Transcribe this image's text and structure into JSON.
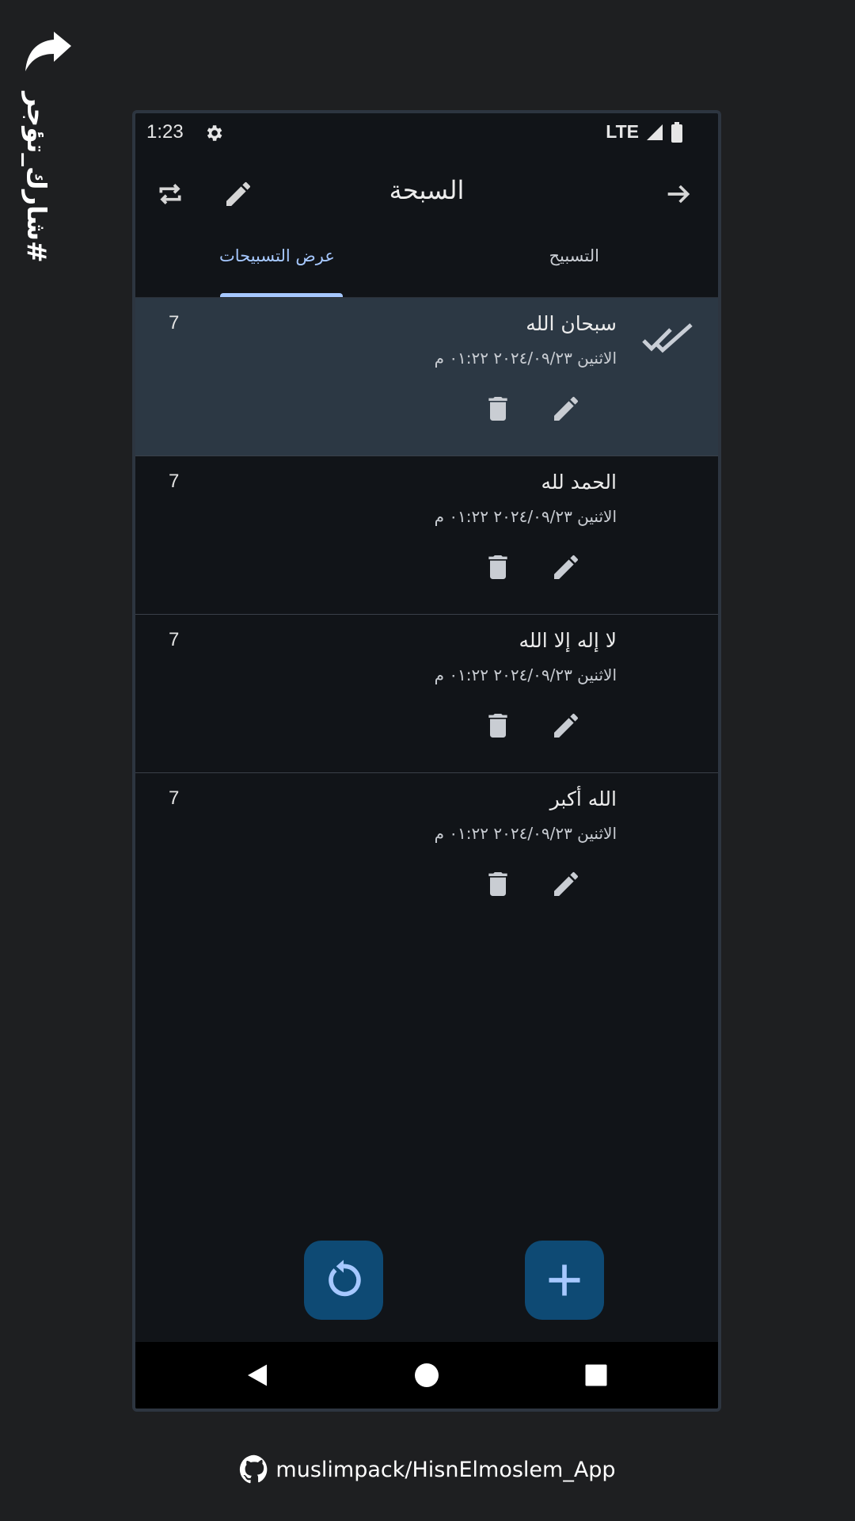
{
  "side": {
    "hashtag": "#شارك_تؤجر",
    "share_icon": "share-arrow-icon"
  },
  "status_bar": {
    "time": "1:23",
    "network": "LTE",
    "icons": [
      "gear-icon",
      "signal-icon",
      "battery-icon"
    ]
  },
  "app_bar": {
    "title": "السبحة",
    "icons": [
      "back-arrow-icon",
      "edit-icon",
      "swap-icon"
    ]
  },
  "tabs": [
    {
      "label": "التسبيح",
      "active": false
    },
    {
      "label": "عرض التسبيحات",
      "active": true
    }
  ],
  "items": [
    {
      "title": "سبحان الله",
      "date": "الاثنين ٢٠٢٤/٠٩/٢٣  ٠١:٢٢ م",
      "count": "7",
      "selected": true
    },
    {
      "title": "الحمد لله",
      "date": "الاثنين ٢٠٢٤/٠٩/٢٣  ٠١:٢٢ م",
      "count": "7",
      "selected": false
    },
    {
      "title": "لا إله إلا الله",
      "date": "الاثنين ٢٠٢٤/٠٩/٢٣  ٠١:٢٢ م",
      "count": "7",
      "selected": false
    },
    {
      "title": "الله أكبر",
      "date": "الاثنين ٢٠٢٤/٠٩/٢٣  ٠١:٢٢ م",
      "count": "7",
      "selected": false
    }
  ],
  "fabs": {
    "reset_icon": "reset-icon",
    "add_icon": "add-icon"
  },
  "nav_bar": [
    "back-triangle-icon",
    "home-circle-icon",
    "recents-square-icon"
  ],
  "footer": {
    "repo": "muslimpack/HisnElmoslem_App",
    "icon": "github-icon"
  },
  "colors": {
    "accent": "#a6c8ff",
    "fab": "#0e4a74",
    "selected_row": "#2c3844",
    "background": "#111418"
  }
}
